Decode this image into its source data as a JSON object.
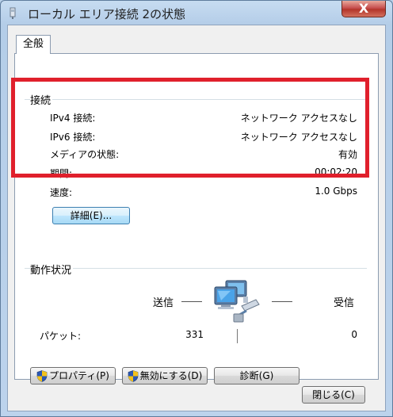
{
  "window": {
    "title": "ローカル エリア接続 2の状態",
    "close_glyph": "X"
  },
  "tabs": [
    {
      "label": "全般"
    }
  ],
  "connection": {
    "group_title": "接続",
    "rows": [
      {
        "label": "IPv4 接続:",
        "value": "ネットワーク アクセスなし"
      },
      {
        "label": "IPv6 接続:",
        "value": "ネットワーク アクセスなし"
      },
      {
        "label": "メディアの状態:",
        "value": "有効"
      },
      {
        "label": "期間:",
        "value": "00:02:20"
      },
      {
        "label": "速度:",
        "value": "1.0 Gbps"
      }
    ],
    "details_button": "詳細(E)..."
  },
  "activity": {
    "group_title": "動作状況",
    "sent_label": "送信",
    "received_label": "受信",
    "packets_label": "パケット:",
    "packets_sent": "331",
    "packets_received": "0"
  },
  "buttons": {
    "properties": "プロパティ(P)",
    "disable": "無効にする(D)",
    "diagnose": "診断(G)",
    "close": "閉じる(C)"
  },
  "annotation": {
    "color": "#e0202c"
  }
}
